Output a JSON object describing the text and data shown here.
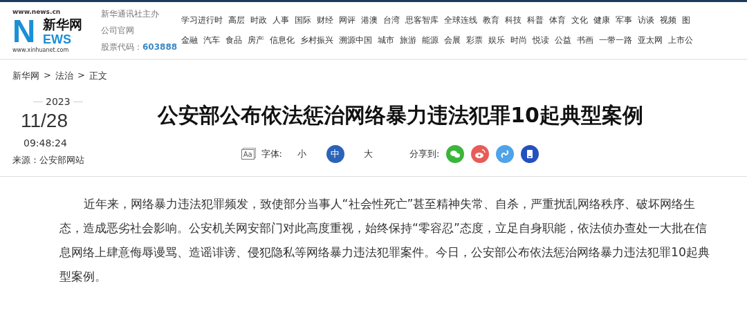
{
  "logo": {
    "url_top": "www.news.cn",
    "brand": "新华网",
    "letter": "N",
    "word": "EWS",
    "url_bottom": "www.xinhuanet.com"
  },
  "sponsor": {
    "line1": "新华通讯社主办",
    "line2": "公司官网",
    "stock_label": "股票代码：",
    "stock_code": "603888"
  },
  "nav_rows": [
    [
      "学习进行时",
      "高层",
      "时政",
      "人事",
      "国际",
      "财经",
      "网评",
      "港澳",
      "台湾",
      "思客智库",
      "全球连线",
      "教育",
      "科技",
      "科普",
      "体育",
      "文化",
      "健康",
      "军事",
      "访谈",
      "视频",
      "图"
    ],
    [
      "金融",
      "汽车",
      "食品",
      "房产",
      "信息化",
      "乡村振兴",
      "溯源中国",
      "城市",
      "旅游",
      "能源",
      "会展",
      "彩票",
      "娱乐",
      "时尚",
      "悦读",
      "公益",
      "书画",
      "一带一路",
      "亚太网",
      "上市公"
    ]
  ],
  "breadcrumb": [
    {
      "label": "新华网"
    },
    {
      "label": "法治"
    },
    {
      "label": "正文"
    }
  ],
  "breadcrumb_separator": ">",
  "date": {
    "year": "2023",
    "day": "11/28",
    "time": "09:48:24"
  },
  "source": "来源：公安部网站",
  "title": "公安部公布依法惩治网络暴力违法犯罪10起典型案例",
  "font_size": {
    "icon_text": "Aa",
    "label": "字体:",
    "options": [
      {
        "label": "小",
        "selected": false
      },
      {
        "label": "中",
        "selected": true
      },
      {
        "label": "大",
        "selected": false
      }
    ]
  },
  "share": {
    "label": "分享到:",
    "targets": [
      {
        "kind": "wechat",
        "color": "#3bb53a"
      },
      {
        "kind": "weibo",
        "color": "#e85b57"
      },
      {
        "kind": "link",
        "color": "#4fa3e8"
      },
      {
        "kind": "phone",
        "color": "#2550c0"
      }
    ]
  },
  "body": "近年来，网络暴力违法犯罪频发，致使部分当事人“社会性死亡”甚至精神失常、自杀，严重扰乱网络秩序、破坏网络生态，造成恶劣社会影响。公安机关网安部门对此高度重视，始终保持“零容忍”态度，立足自身职能，依法侦办查处一大批在信息网络上肆意侮辱谩骂、造谣诽谤、侵犯隐私等网络暴力违法犯罪案件。今日，公安部公布依法惩治网络暴力违法犯罪10起典型案例。"
}
